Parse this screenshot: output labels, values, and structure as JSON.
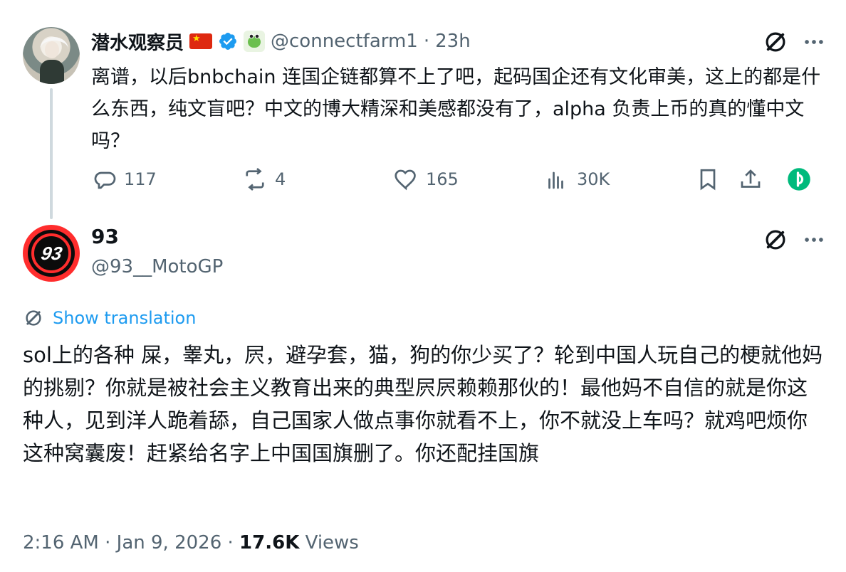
{
  "parent": {
    "display_name": "潜水观察员",
    "handle": "@connectfarm1",
    "time": "23h",
    "text": "离谱，以后bnbchain 连国企链都算不上了吧，起码国企还有文化审美，这上的都是什么东西，纯文盲吧？中文的博大精深和美感都没有了，alpha 负责上币的真的懂中文吗？",
    "actions": {
      "replies": "117",
      "reposts": "4",
      "likes": "165",
      "views": "30K"
    }
  },
  "reply": {
    "display_name": "93",
    "avatar_text": "93",
    "handle": "@93__MotoGP",
    "translate_label": "Show translation",
    "text": "sol上的各种 屎，睾丸，屄，避孕套，猫，狗的你少买了？轮到中国人玩自己的梗就他妈的挑剔？你就是被社会主义教育出来的典型屄屄赖赖那伙的！最他妈不自信的就是你这种人，见到洋人跪着舔，自己国家人做点事你就看不上，你不就没上车吗？就鸡吧烦你这种窝囊废！赶紧给名字上中国国旗删了。你还配挂国旗",
    "timestamp": "2:16 AM · Jan 9, 2026 · ",
    "views_count": "17.6K",
    "views_label": "Views"
  },
  "colors": {
    "accent": "#1d9bf0",
    "muted": "#536471",
    "text": "#0f1419",
    "green": "#00ba7c"
  },
  "icons": {
    "verified": "verified-badge-icon",
    "reply": "reply-icon",
    "repost": "repost-icon",
    "like": "heart-icon",
    "views": "views-icon",
    "bookmark": "bookmark-icon",
    "share": "share-icon",
    "grok": "grok-icon",
    "more": "more-icon",
    "translate": "translate-icon"
  }
}
